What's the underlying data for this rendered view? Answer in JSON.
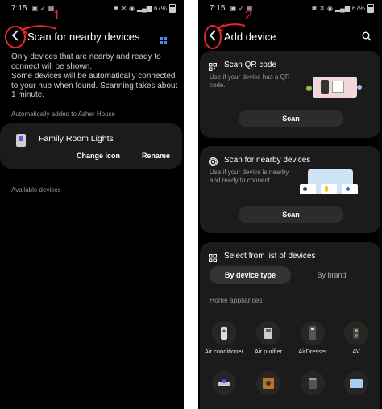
{
  "left_screen": {
    "status": {
      "time": "7:15",
      "battery": "67%"
    },
    "annotation_number": "1",
    "title": "Scan for nearby devices",
    "intro": "Only devices that are nearby and ready to connect will be shown.",
    "scan_note": "Some devices will be automatically connected to your hub when found. Scanning takes about 1 minute.",
    "auto_added_label": "Automatically added to Asher House",
    "device": {
      "name": "Family Room Lights",
      "change_icon_label": "Change icon",
      "rename_label": "Rename"
    },
    "available_label": "Available devices"
  },
  "right_screen": {
    "status": {
      "time": "7:15",
      "battery": "67%"
    },
    "annotation_number": "2",
    "title": "Add device",
    "qr_card": {
      "title": "Scan QR code",
      "desc": "Use if your device has a QR code.",
      "button": "Scan"
    },
    "nearby_card": {
      "title": "Scan for nearby devices",
      "desc": "Use if your device is nearby and ready to connect.",
      "button": "Scan"
    },
    "list_card": {
      "title": "Select from list of devices",
      "tabs": [
        "By device type",
        "By brand"
      ],
      "section": "Home appliances",
      "appliances": [
        "Air conditioner",
        "Air purifier",
        "AirDresser",
        "AV"
      ]
    }
  },
  "colors": {
    "annotation": "#e8262b",
    "background": "#000000",
    "card": "#1b1b1b",
    "button": "#2c2c2c"
  }
}
